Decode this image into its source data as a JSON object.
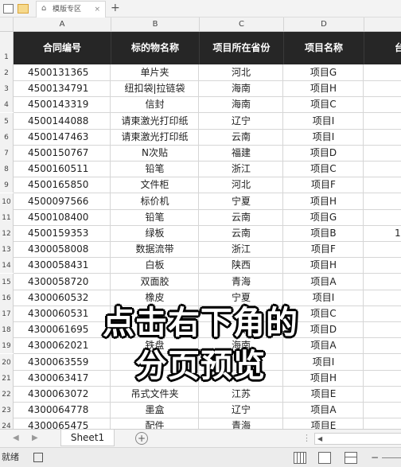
{
  "tabbar": {
    "tab_label": "模版专区",
    "close": "×",
    "new_tab": "+"
  },
  "columns": [
    "A",
    "B",
    "C",
    "D"
  ],
  "header": [
    "合同编号",
    "标的物名称",
    "项目所在省份",
    "项目名称"
  ],
  "header_partial_e": "台",
  "row_numbers": [
    "1",
    "2",
    "3",
    "4",
    "5",
    "6",
    "7",
    "8",
    "9",
    "10",
    "11",
    "12",
    "13",
    "14",
    "15",
    "16",
    "17",
    "18",
    "19",
    "20",
    "21",
    "22",
    "23",
    "24"
  ],
  "rows": [
    [
      "4500131365",
      "单片夹",
      "河北",
      "项目G",
      ""
    ],
    [
      "4500134791",
      "纽扣袋|拉链袋",
      "海南",
      "项目H",
      ""
    ],
    [
      "4500143319",
      "信封",
      "海南",
      "项目C",
      ""
    ],
    [
      "4500144088",
      "请柬激光打印纸",
      "辽宁",
      "项目I",
      ""
    ],
    [
      "4500147463",
      "请柬激光打印纸",
      "云南",
      "项目I",
      ""
    ],
    [
      "4500150767",
      "N次贴",
      "福建",
      "项目D",
      ""
    ],
    [
      "4500160511",
      "铅笔",
      "浙江",
      "项目C",
      ""
    ],
    [
      "4500165850",
      "文件柜",
      "河北",
      "项目F",
      ""
    ],
    [
      "4500097566",
      "标价机",
      "宁夏",
      "项目H",
      ""
    ],
    [
      "4500108400",
      "铅笔",
      "云南",
      "项目G",
      ""
    ],
    [
      "4500159353",
      "绿板",
      "云南",
      "项目B",
      "1,"
    ],
    [
      "4300058008",
      "数据流带",
      "浙江",
      "项目F",
      ""
    ],
    [
      "4300058431",
      "白板",
      "陕西",
      "项目H",
      ""
    ],
    [
      "4300058720",
      "双面胶",
      "青海",
      "项目A",
      ""
    ],
    [
      "4300060532",
      "橡皮",
      "宁夏",
      "项目I",
      ""
    ],
    [
      "4300060531",
      "",
      "",
      "项目C",
      ""
    ],
    [
      "4300061695",
      "",
      "云",
      "项目D",
      ""
    ],
    [
      "4300062021",
      "铁盘",
      "海南",
      "项目A",
      ""
    ],
    [
      "4300063559",
      "",
      "",
      "项目I",
      ""
    ],
    [
      "4300063417",
      "",
      "",
      "项目H",
      ""
    ],
    [
      "4300063072",
      "吊式文件夹",
      "江苏",
      "项目E",
      ""
    ],
    [
      "4300064778",
      "墨盒",
      "辽宁",
      "项目A",
      ""
    ],
    [
      "4300065475",
      "配件",
      "青海",
      "项目E",
      ""
    ]
  ],
  "overlay": {
    "line1": "点击右下角的",
    "line2": "分页预览"
  },
  "sheetbar": {
    "sheet_name": "Sheet1",
    "add": "+",
    "dots": "⋮",
    "scroll_left": "◀"
  },
  "statusbar": {
    "ready": "就绪",
    "zoom_minus": "−"
  }
}
